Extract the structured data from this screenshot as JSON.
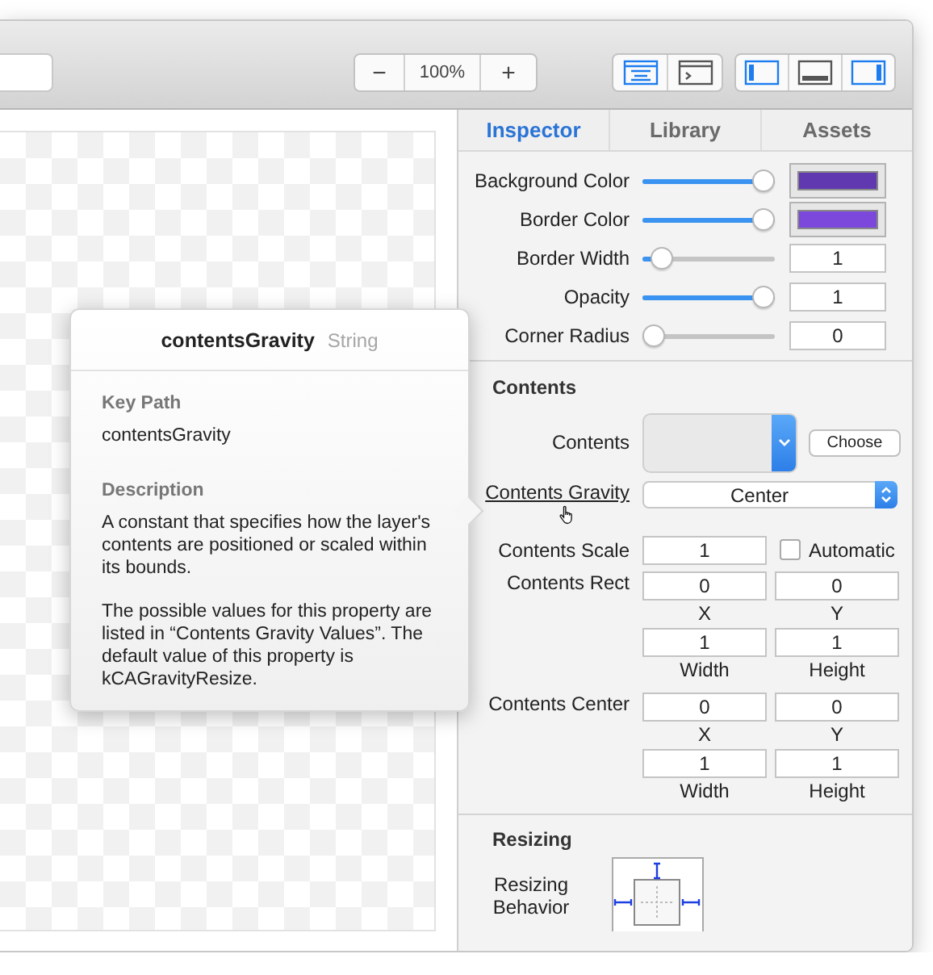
{
  "toolbar": {
    "zoom": {
      "minus": "−",
      "value": "100%",
      "plus": "+"
    },
    "view_groups": [
      [
        {
          "on": true
        },
        {
          "on": false
        }
      ],
      [
        {
          "on": true
        },
        {
          "on": false
        },
        {
          "on": true
        }
      ]
    ]
  },
  "tabs": [
    {
      "label": "Inspector",
      "selected": true
    },
    {
      "label": "Library",
      "selected": false
    },
    {
      "label": "Assets",
      "selected": false
    }
  ],
  "properties": [
    {
      "kind": "color",
      "label": "Background Color",
      "level": 1,
      "color": "#6039b0"
    },
    {
      "kind": "color",
      "label": "Border Color",
      "level": 1,
      "color": "#7c48dc"
    },
    {
      "kind": "number",
      "label": "Border Width",
      "level": 0.08,
      "value": "1"
    },
    {
      "kind": "number",
      "label": "Opacity",
      "level": 1,
      "value": "1"
    },
    {
      "kind": "number",
      "label": "Corner Radius",
      "level": 0,
      "value": "0"
    }
  ],
  "contents": {
    "title": "Contents",
    "rows": [
      {
        "kind": "image",
        "label": "Contents",
        "button": "Choose"
      },
      {
        "kind": "select",
        "label": "Contents Gravity",
        "value": "Center",
        "hovered": true
      },
      {
        "kind": "scale",
        "label": "Contents Scale",
        "value": "1",
        "checkbox": "Automatic",
        "checked": false
      },
      {
        "kind": "rect",
        "label": "Contents Rect",
        "fields": [
          {
            "value": "0",
            "caption": "X"
          },
          {
            "value": "0",
            "caption": "Y"
          },
          {
            "value": "1",
            "caption": "Width"
          },
          {
            "value": "1",
            "caption": "Height"
          }
        ]
      },
      {
        "kind": "rect",
        "label": "Contents Center",
        "fields": [
          {
            "value": "0",
            "caption": "X"
          },
          {
            "value": "0",
            "caption": "Y"
          },
          {
            "value": "1",
            "caption": "Width"
          },
          {
            "value": "1",
            "caption": "Height"
          }
        ]
      }
    ]
  },
  "resizing": {
    "title": "Resizing",
    "label": "Resizing Behavior"
  },
  "popover": {
    "title": "contentsGravity",
    "type": "String",
    "sections": [
      {
        "heading": "Key Path",
        "paragraphs": [
          "contentsGravity"
        ]
      },
      {
        "heading": "Description",
        "paragraphs": [
          "A constant that specifies how the layer's contents are positioned or scaled within its bounds.",
          "The possible values for this property are listed in “Contents Gravity Values”. The default value of this property is kCAGravityResize."
        ]
      }
    ]
  }
}
